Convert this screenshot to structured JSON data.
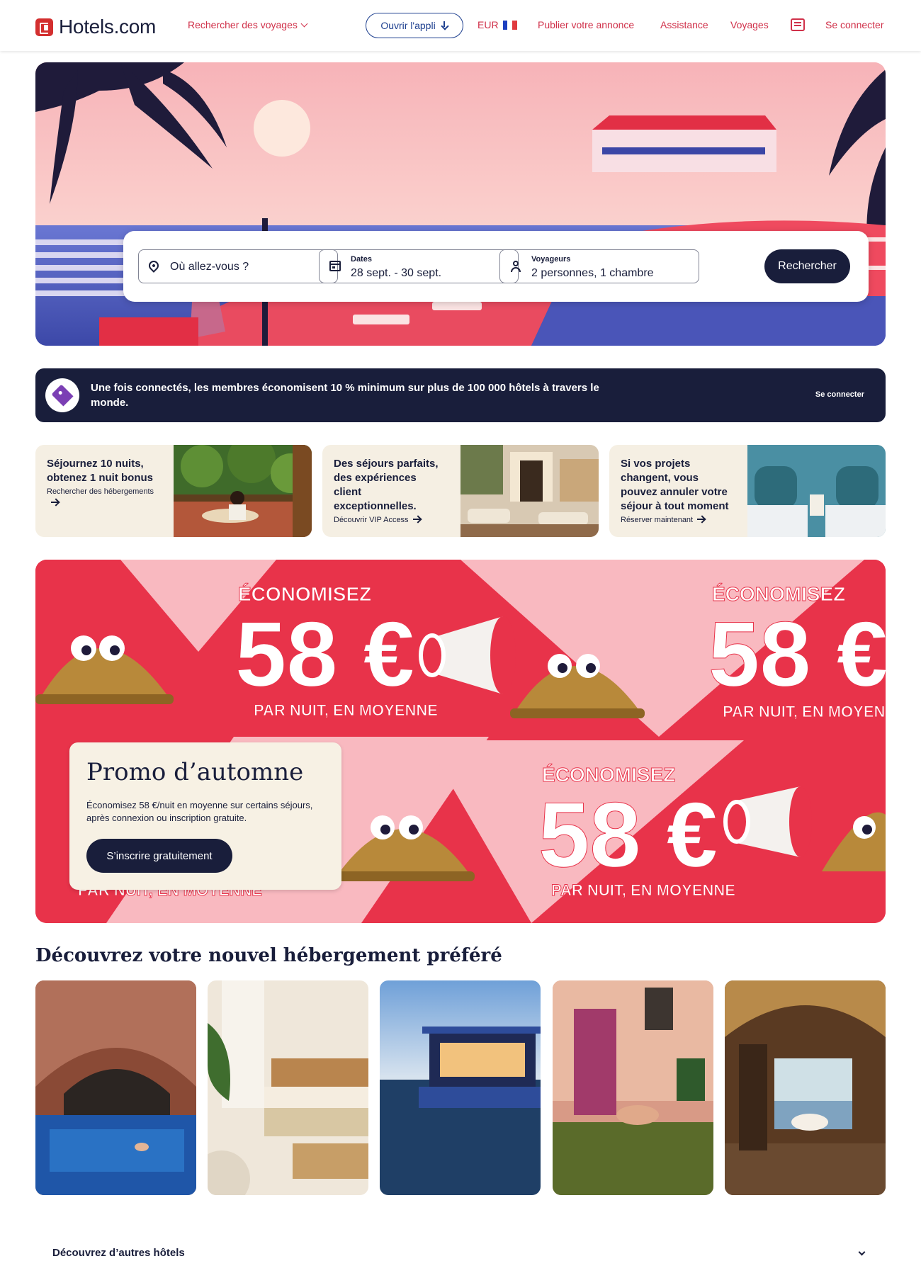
{
  "header": {
    "logo_text": "Hotels.com",
    "nav_search_trips": "Rechercher des voyages",
    "open_app": "Ouvrir l'appli",
    "currency": "EUR",
    "publish_listing": "Publier votre annonce",
    "support": "Assistance",
    "trips": "Voyages",
    "sign_in": "Se connecter"
  },
  "search": {
    "destination_placeholder": "Où allez-vous ?",
    "dates_label": "Dates",
    "dates_value": "28 sept. - 30 sept.",
    "travelers_label": "Voyageurs",
    "travelers_value": "2 personnes, 1 chambre",
    "button": "Rechercher"
  },
  "member_banner": {
    "text": "Une fois connectés, les membres économisent 10 % minimum sur plus de 100 000 hôtels à travers le monde.",
    "link": "Se connecter"
  },
  "promo_cards": [
    {
      "title": "Séjournez 10 nuits, obtenez 1 nuit bonus",
      "link": "Rechercher des hébergements"
    },
    {
      "title": "Des séjours parfaits, des expériences client exceptionnelles.",
      "link": "Découvrir VIP Access"
    },
    {
      "title": "Si vos projets changent, vous pouvez annuler votre séjour à tout moment",
      "link": "Réserver maintenant"
    }
  ],
  "autumn_promo": {
    "title": "Promo d’automne",
    "description": "Économisez 58 €/nuit en moyenne sur certains séjours, après connexion ou inscription gratuite.",
    "button": "S’inscrire gratuitement",
    "banner_save": "ÉCONOMISEZ",
    "banner_amount": "58 €",
    "banner_sub": "PAR NUIT, EN MOYENNE"
  },
  "discover": {
    "title": "Découvrez votre nouvel hébergement préféré",
    "cards": [
      "Piscine voûtée",
      "Chambre lumineuse",
      "Maison flottante",
      "Bassin de villa",
      "Salle de bain vue mer"
    ]
  },
  "more_hotels": {
    "label": "Découvrez d’autres hôtels"
  },
  "colors": {
    "brand_red": "#d32f2f",
    "navy": "#191e3b",
    "link_red": "#d0314a",
    "promo_red": "#e8334a",
    "cream": "#f5efe3"
  },
  "icons": [
    "hotels-logo-icon",
    "chevron-down-icon",
    "download-icon",
    "france-flag-icon",
    "message-icon",
    "location-pin-icon",
    "calendar-icon",
    "user-icon",
    "price-tag-icon",
    "arrow-right-icon"
  ]
}
